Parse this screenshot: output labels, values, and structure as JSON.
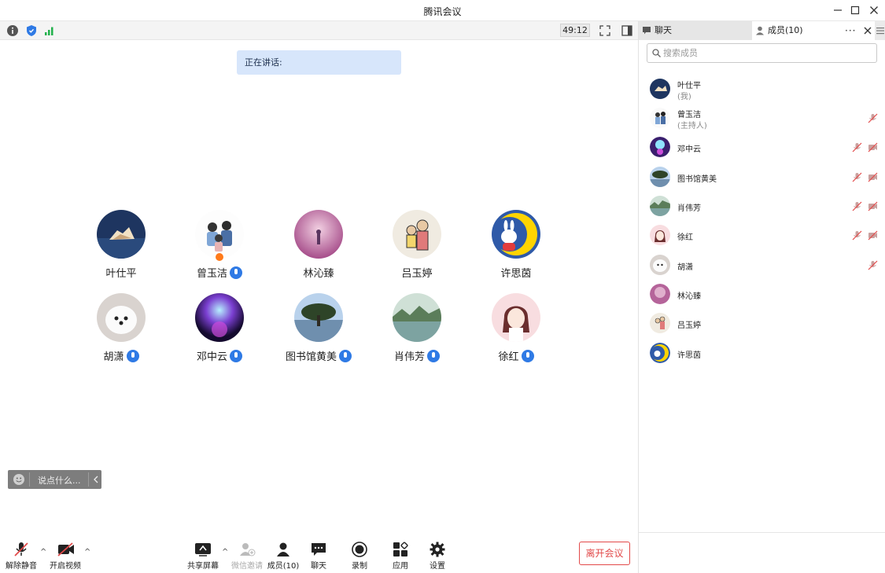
{
  "window": {
    "title": "腾讯会议"
  },
  "meeting": {
    "timer": "49:12",
    "speaking_label": "正在讲话:",
    "chat_input_placeholder": "说点什么...",
    "participants": [
      {
        "name": "叶仕平",
        "mic_badge": false,
        "host": false
      },
      {
        "name": "曾玉洁",
        "mic_badge": true,
        "host": true
      },
      {
        "name": "林沁臻",
        "mic_badge": false,
        "host": false
      },
      {
        "name": "吕玉婷",
        "mic_badge": false,
        "host": false
      },
      {
        "name": "许思茵",
        "mic_badge": false,
        "host": false
      },
      {
        "name": "胡潇",
        "mic_badge": true,
        "host": false
      },
      {
        "name": "邓中云",
        "mic_badge": true,
        "host": false
      },
      {
        "name": "图书馆黄美",
        "mic_badge": true,
        "host": false
      },
      {
        "name": "肖伟芳",
        "mic_badge": true,
        "host": false
      },
      {
        "name": "徐红",
        "mic_badge": true,
        "host": false
      }
    ]
  },
  "toolbar": {
    "unmute": "解除静音",
    "start_video": "开启视频",
    "share_screen": "共享屏幕",
    "wechat_invite": "微信邀请",
    "members": "成员(10)",
    "chat": "聊天",
    "record": "录制",
    "apps": "应用",
    "settings": "设置",
    "leave": "离开会议"
  },
  "panel": {
    "tab_chat": "聊天",
    "tab_members": "成员(10)",
    "search_placeholder": "搜索成员",
    "members": [
      {
        "name": "叶仕平",
        "sub": "(我)",
        "mic_muted": false,
        "video_off": false
      },
      {
        "name": "曾玉洁",
        "sub": "(主持人)",
        "mic_muted": true,
        "video_off": false
      },
      {
        "name": "邓中云",
        "sub": "",
        "mic_muted": true,
        "video_off": true
      },
      {
        "name": "图书馆黄美",
        "sub": "",
        "mic_muted": true,
        "video_off": true
      },
      {
        "name": "肖伟芳",
        "sub": "",
        "mic_muted": true,
        "video_off": true
      },
      {
        "name": "徐红",
        "sub": "",
        "mic_muted": true,
        "video_off": true
      },
      {
        "name": "胡潇",
        "sub": "",
        "mic_muted": true,
        "video_off": false
      },
      {
        "name": "林沁臻",
        "sub": "",
        "mic_muted": false,
        "video_off": false
      },
      {
        "name": "吕玉婷",
        "sub": "",
        "mic_muted": false,
        "video_off": false
      },
      {
        "name": "许思茵",
        "sub": "",
        "mic_muted": false,
        "video_off": false
      }
    ]
  },
  "colors": {
    "accent": "#2f7ae5",
    "danger": "#e24a4a",
    "speaking_bg": "#d7e6fb"
  }
}
